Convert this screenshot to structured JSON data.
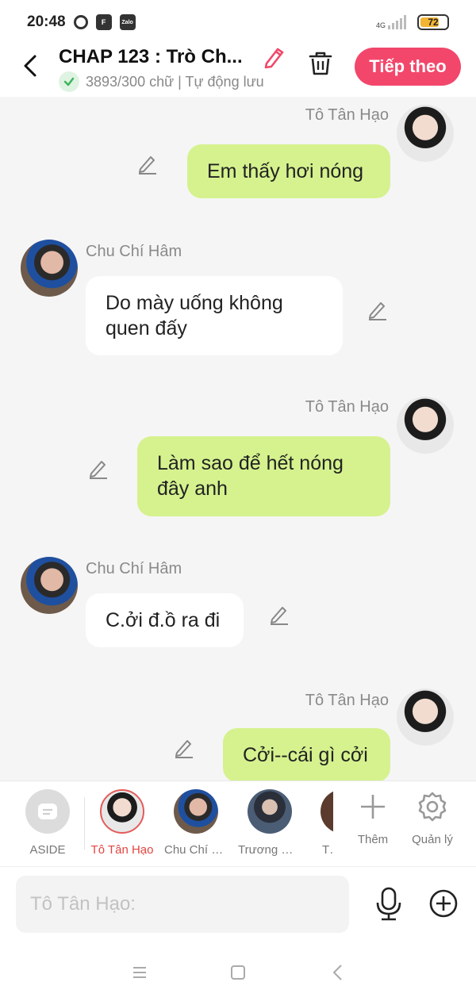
{
  "status_bar": {
    "time": "20:48",
    "apps": [
      "F",
      "Zalo"
    ],
    "network": "4G",
    "battery": "72"
  },
  "header": {
    "title": "CHAP 123 : Trò Ch...",
    "word_count": "3893/300 chữ | Tự động lưu",
    "next_label": "Tiếp theo",
    "accent_color": "#f2476b"
  },
  "messages": [
    {
      "sender": "Tô Tân Hạo",
      "side": "right",
      "text_lines": [
        "Em thấy hơi nóng"
      ]
    },
    {
      "sender": "Chu Chí Hâm",
      "side": "left",
      "text_lines": [
        "Do mày uống không",
        "quen đấy"
      ]
    },
    {
      "sender": "Tô Tân Hạo",
      "side": "right",
      "text_lines": [
        "Làm sao để hết nóng",
        "đây anh"
      ]
    },
    {
      "sender": "Chu Chí Hâm",
      "side": "left",
      "text_lines": [
        "C.ởi đ.ồ ra đi"
      ]
    },
    {
      "sender": "Tô Tân Hạo",
      "side": "right",
      "text_lines": [
        "Cởi--cái gì cởi"
      ]
    }
  ],
  "characters": [
    {
      "label": "ASIDE"
    },
    {
      "label": "Tô Tân Hạo",
      "active": true
    },
    {
      "label": "Chu Chí H..."
    },
    {
      "label": "Trương Cực"
    },
    {
      "label": "Tả"
    }
  ],
  "tools": {
    "add_label": "Thêm",
    "manage_label": "Quản lý"
  },
  "composer": {
    "placeholder": "Tô Tân Hạo:"
  }
}
